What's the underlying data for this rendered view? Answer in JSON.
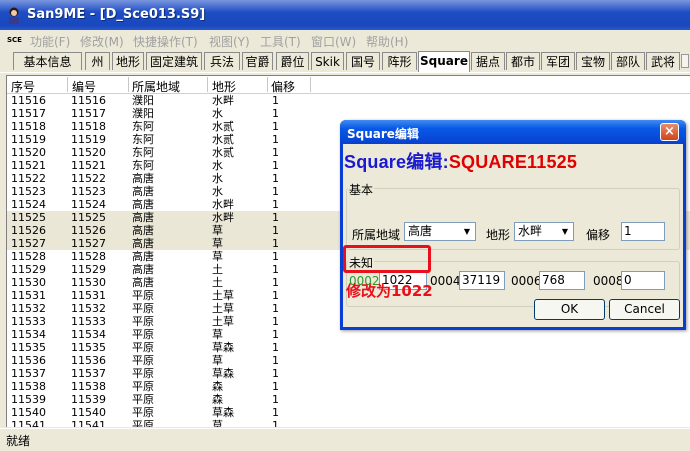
{
  "window": {
    "title": "San9ME - [D_Sce013.S9]"
  },
  "menu": {
    "sys_label": "SCE",
    "items": [
      "功能(F)",
      "修改(M)",
      "快捷操作(T)",
      "视图(Y)",
      "工具(T)",
      "窗口(W)",
      "帮助(H)"
    ]
  },
  "tabs": [
    "基本信息",
    "州",
    "地形",
    "固定建筑",
    "兵法",
    "官爵",
    "爵位",
    "Skik",
    "国号",
    "阵形",
    "Square",
    "据点",
    "都市",
    "军团",
    "宝物",
    "部队",
    "武将"
  ],
  "list": {
    "columns": [
      "序号",
      "编号",
      "所属地域",
      "地形",
      "偏移"
    ],
    "rows": [
      [
        "11516",
        "11516",
        "濮阳",
        "水畔",
        "1"
      ],
      [
        "11517",
        "11517",
        "濮阳",
        "水",
        "1"
      ],
      [
        "11518",
        "11518",
        "东阿",
        "水贰",
        "1"
      ],
      [
        "11519",
        "11519",
        "东阿",
        "水贰",
        "1"
      ],
      [
        "11520",
        "11520",
        "东阿",
        "水贰",
        "1"
      ],
      [
        "11521",
        "11521",
        "东阿",
        "水",
        "1"
      ],
      [
        "11522",
        "11522",
        "高唐",
        "水",
        "1"
      ],
      [
        "11523",
        "11523",
        "高唐",
        "水",
        "1"
      ],
      [
        "11524",
        "11524",
        "高唐",
        "水畔",
        "1"
      ],
      [
        "11525",
        "11525",
        "高唐",
        "水畔",
        "1"
      ],
      [
        "11526",
        "11526",
        "高唐",
        "草",
        "1"
      ],
      [
        "11527",
        "11527",
        "高唐",
        "草",
        "1"
      ],
      [
        "11528",
        "11528",
        "高唐",
        "草",
        "1"
      ],
      [
        "11529",
        "11529",
        "高唐",
        "土",
        "1"
      ],
      [
        "11530",
        "11530",
        "高唐",
        "土",
        "1"
      ],
      [
        "11531",
        "11531",
        "平原",
        "土草",
        "1"
      ],
      [
        "11532",
        "11532",
        "平原",
        "土草",
        "1"
      ],
      [
        "11533",
        "11533",
        "平原",
        "土草",
        "1"
      ],
      [
        "11534",
        "11534",
        "平原",
        "草",
        "1"
      ],
      [
        "11535",
        "11535",
        "平原",
        "草森",
        "1"
      ],
      [
        "11536",
        "11536",
        "平原",
        "草",
        "1"
      ],
      [
        "11537",
        "11537",
        "平原",
        "草森",
        "1"
      ],
      [
        "11538",
        "11538",
        "平原",
        "森",
        "1"
      ],
      [
        "11539",
        "11539",
        "平原",
        "森",
        "1"
      ],
      [
        "11540",
        "11540",
        "平原",
        "草森",
        "1"
      ],
      [
        "11541",
        "11541",
        "平原",
        "草",
        "1"
      ]
    ],
    "selected_rows": [
      9,
      10,
      11
    ]
  },
  "dialog": {
    "title": "Square编辑",
    "heading_prefix": "Square编辑:",
    "heading_id": "SQUARE11525",
    "close_glyph": "×",
    "basic": {
      "group_label": "基本",
      "region_label": "所属地域",
      "region_value": "高唐",
      "terrain_label": "地形",
      "terrain_value": "水畔",
      "offset_label": "偏移",
      "offset_value": "1"
    },
    "unknown": {
      "group_label": "未知",
      "f1_label": "0002",
      "f1_value": "1022",
      "f2_label": "0004",
      "f2_value": "37119",
      "f3_label": "0006",
      "f3_value": "768",
      "f4_label": "0008",
      "f4_value": "0"
    },
    "ok_label": "OK",
    "cancel_label": "Cancel"
  },
  "annotation": "修改为1022",
  "status": {
    "text": "就绪"
  },
  "colors": {
    "heading_blue": "#1a1ad0",
    "heading_red": "#e00000",
    "annotation_red": "#e8101a",
    "field_label_green": "#2a9a2a"
  }
}
